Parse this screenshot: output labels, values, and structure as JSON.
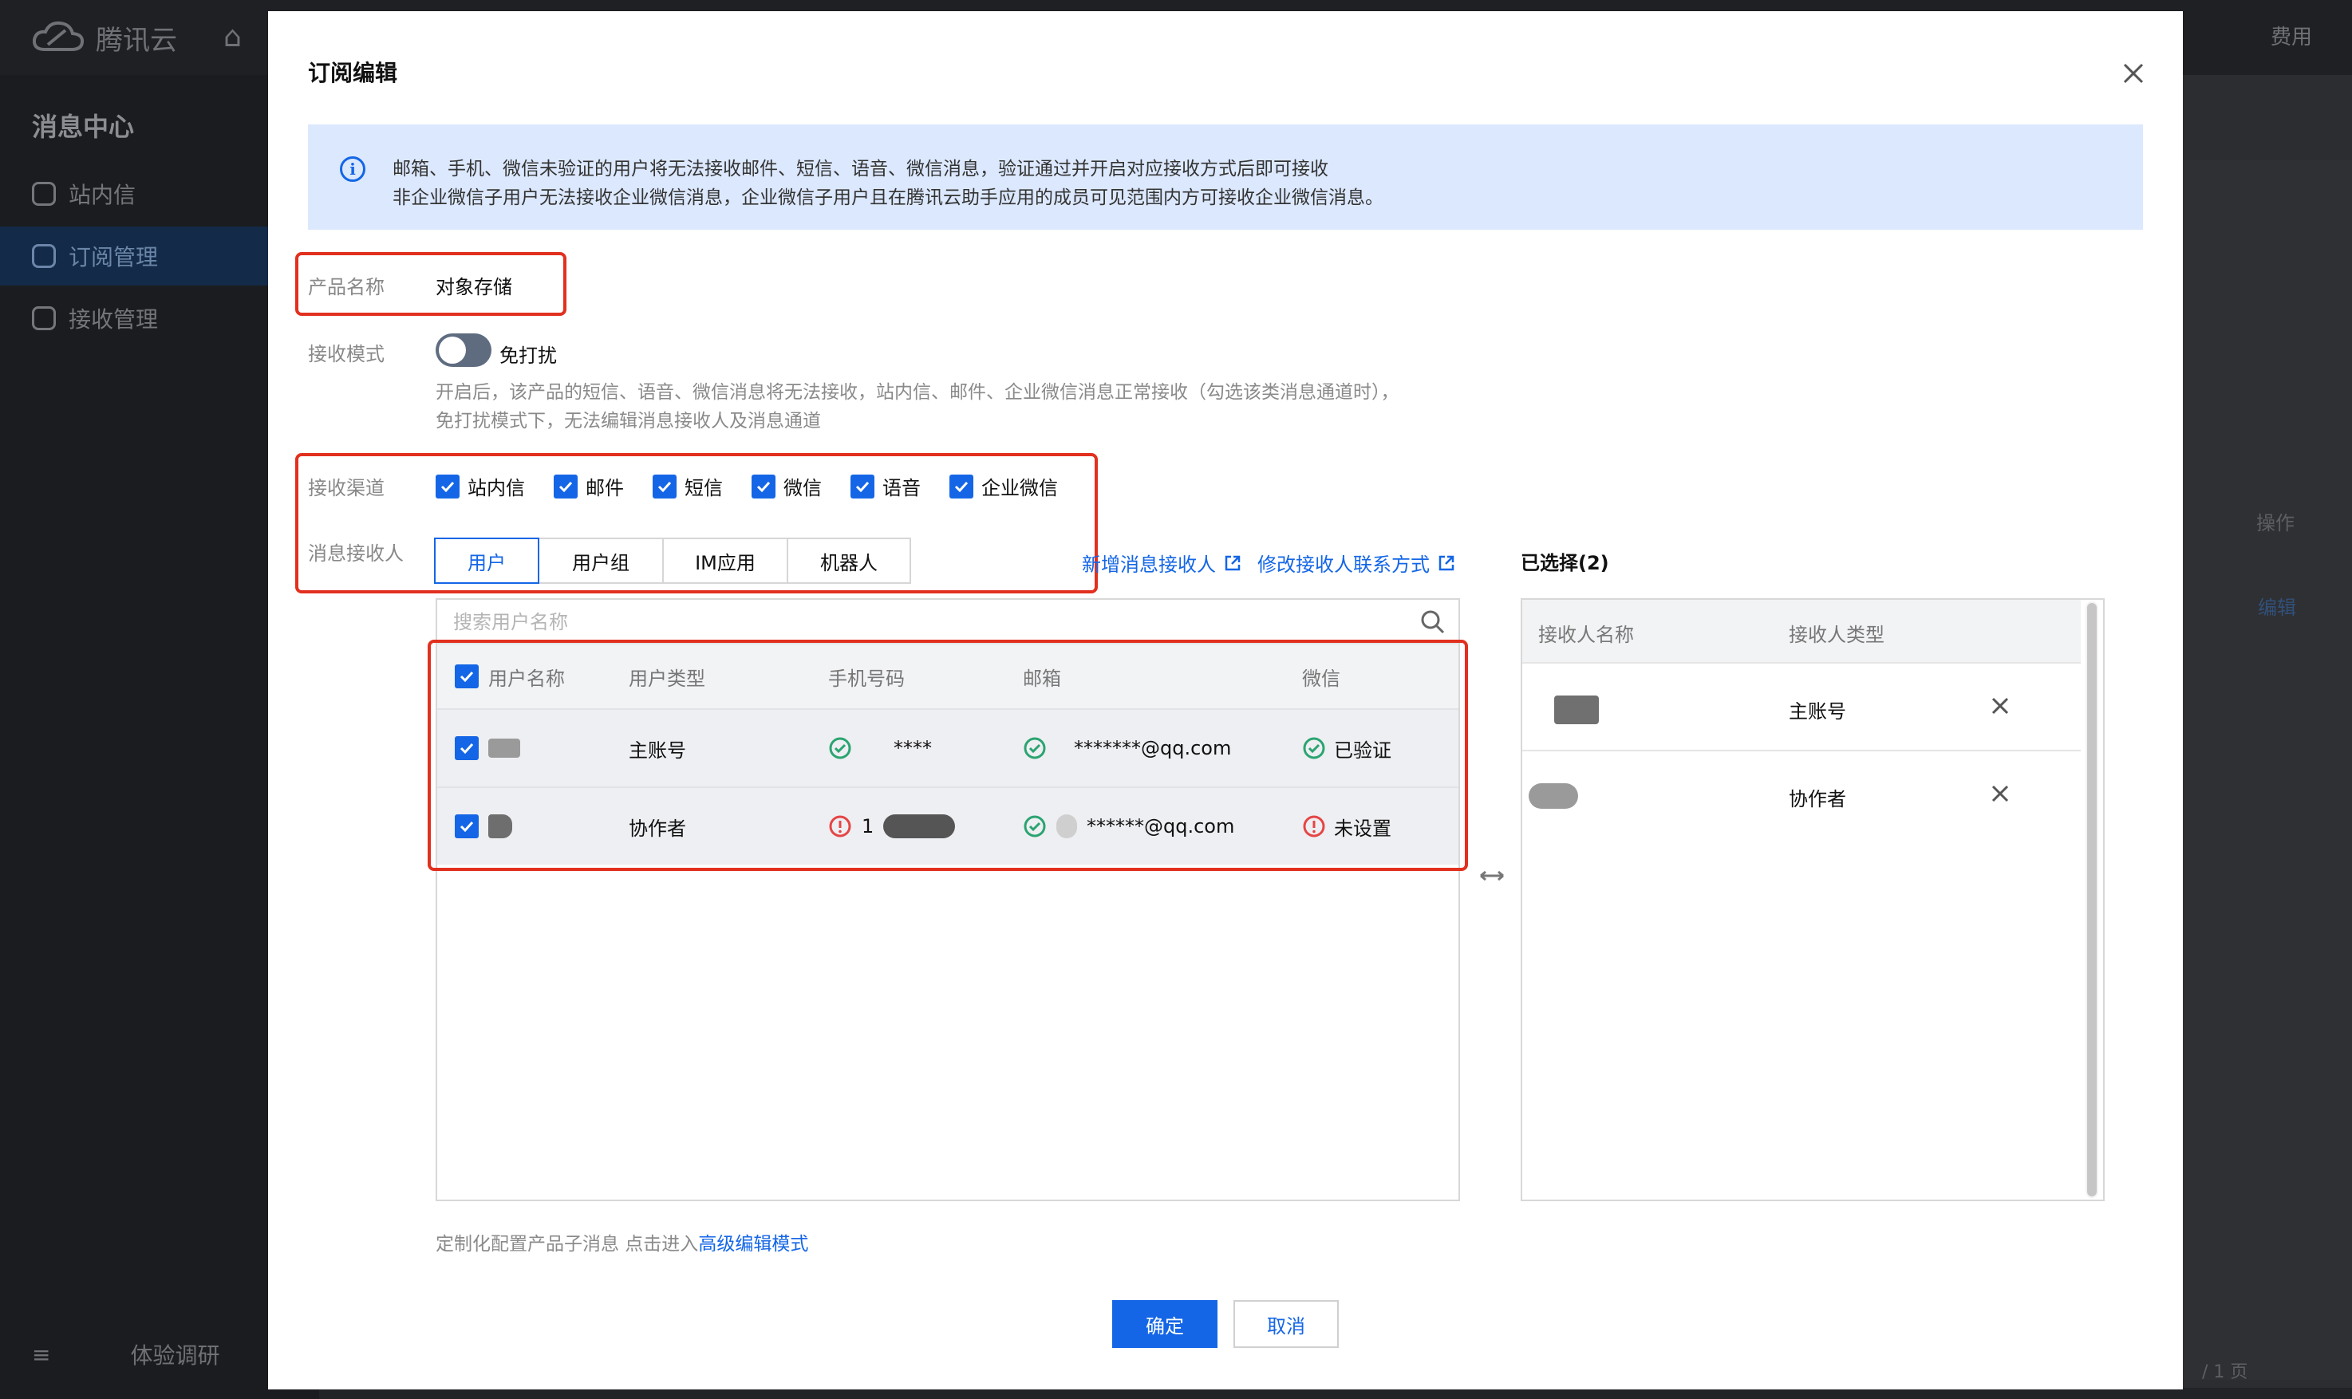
{
  "background": {
    "brand": "腾讯云",
    "top_right": [
      "费用"
    ],
    "sidebar_title": "消息中心",
    "nav": [
      {
        "label": "站内信"
      },
      {
        "label": "订阅管理"
      },
      {
        "label": "接收管理"
      }
    ],
    "survey": "体验调研",
    "column_action": "操作",
    "row_action": "编辑",
    "pagination": "/ 1 页"
  },
  "modal": {
    "title": "订阅编辑",
    "notice_lines": [
      "邮箱、手机、微信未验证的用户将无法接收邮件、短信、语音、微信消息，验证通过并开启对应接收方式后即可接收",
      "非企业微信子用户无法接收企业微信消息，企业微信子用户且在腾讯云助手应用的成员可见范围内方可接收企业微信消息。"
    ],
    "product_label": "产品名称",
    "product_value": "对象存储",
    "mode_label": "接收模式",
    "mode_toggle_label": "免打扰",
    "mode_toggle_on": false,
    "mode_hint_lines": [
      "开启后，该产品的短信、语音、微信消息将无法接收，站内信、邮件、企业微信消息正常接收（勾选该类消息通道时），",
      "免打扰模式下，无法编辑消息接收人及消息通道"
    ],
    "channel_label": "接收渠道",
    "channels": [
      {
        "label": "站内信",
        "checked": true
      },
      {
        "label": "邮件",
        "checked": true
      },
      {
        "label": "短信",
        "checked": true
      },
      {
        "label": "微信",
        "checked": true
      },
      {
        "label": "语音",
        "checked": true
      },
      {
        "label": "企业微信",
        "checked": true
      }
    ],
    "recipient_label": "消息接收人",
    "recipient_tabs": [
      "用户",
      "用户组",
      "IM应用",
      "机器人"
    ],
    "active_tab": "用户",
    "links": {
      "add_recipient": "新增消息接收人",
      "edit_contact": "修改接收人联系方式"
    },
    "search_placeholder": "搜索用户名称",
    "table": {
      "columns": [
        "用户名称",
        "用户类型",
        "手机号码",
        "邮箱",
        "微信"
      ],
      "rows": [
        {
          "type": "主账号",
          "phone": "****",
          "phone_status": "ok",
          "email": "*******@qq.com",
          "email_status": "ok",
          "wechat": "已验证",
          "wechat_status": "ok",
          "checked": true
        },
        {
          "type": "协作者",
          "phone": "1",
          "phone_status": "error",
          "email": "******@qq.com",
          "email_status": "ok",
          "wechat": "未设置",
          "wechat_status": "error",
          "checked": true
        }
      ]
    },
    "selected_title": "已选择(2)",
    "selected_columns": [
      "接收人名称",
      "接收人类型"
    ],
    "selected_rows": [
      {
        "type": "主账号"
      },
      {
        "type": "协作者"
      }
    ],
    "footer_tip": "定制化配置产品子消息 点击进入",
    "footer_link": "高级编辑模式",
    "confirm": "确定",
    "cancel": "取消"
  },
  "colors": {
    "accent": "#1466e6",
    "notice_bg": "#dce8fd",
    "highlight_border": "#e2301f",
    "ok": "#2ba471",
    "error": "#e54545"
  }
}
